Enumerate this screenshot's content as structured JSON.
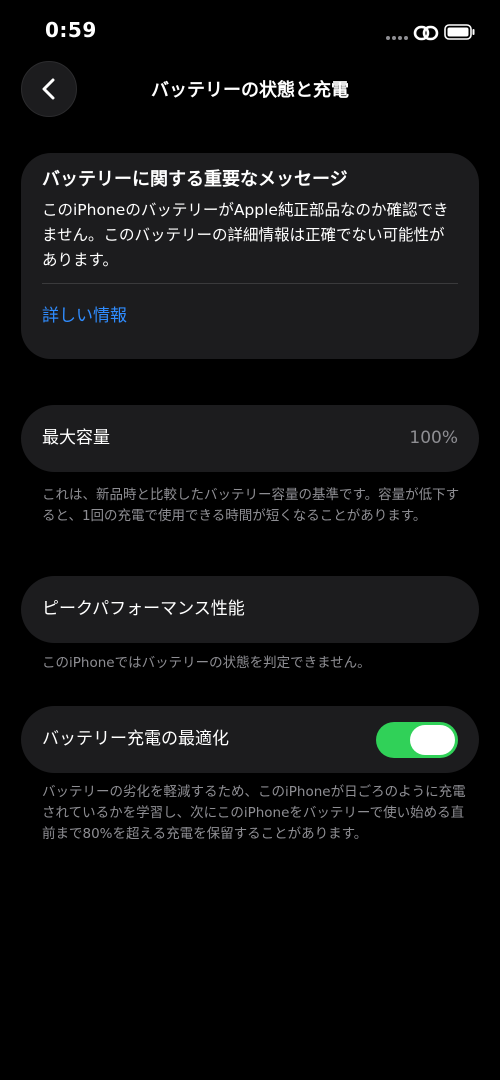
{
  "status": {
    "time": "0:59"
  },
  "nav": {
    "title": "バッテリーの状態と充電"
  },
  "message": {
    "title": "バッテリーに関する重要なメッセージ",
    "body": "このiPhoneのバッテリーがApple純正部品なのか確認できません。このバッテリーの詳細情報は正確でない可能性があります。",
    "link": "詳しい情報"
  },
  "capacity": {
    "label": "最大容量",
    "value": "100%",
    "note": "これは、新品時と比較したバッテリー容量の基準です。容量が低下すると、1回の充電で使用できる時間が短くなることがあります。"
  },
  "peak": {
    "label": "ピークパフォーマンス性能",
    "note": "このiPhoneではバッテリーの状態を判定できません。"
  },
  "optimized": {
    "label": "バッテリー充電の最適化",
    "enabled": true,
    "note": "バッテリーの劣化を軽減するため、このiPhoneが日ごろのように充電されているかを学習し、次にこのiPhoneをバッテリーで使い始める直前まで80%を超える充電を保留することがあります。"
  },
  "colors": {
    "accent": "#2f8cff",
    "toggle_on": "#30d158",
    "card": "#1c1c1e",
    "secondary_text": "#8e8e93"
  },
  "icons": [
    "chevron-left-icon",
    "link-icon",
    "battery-icon"
  ]
}
